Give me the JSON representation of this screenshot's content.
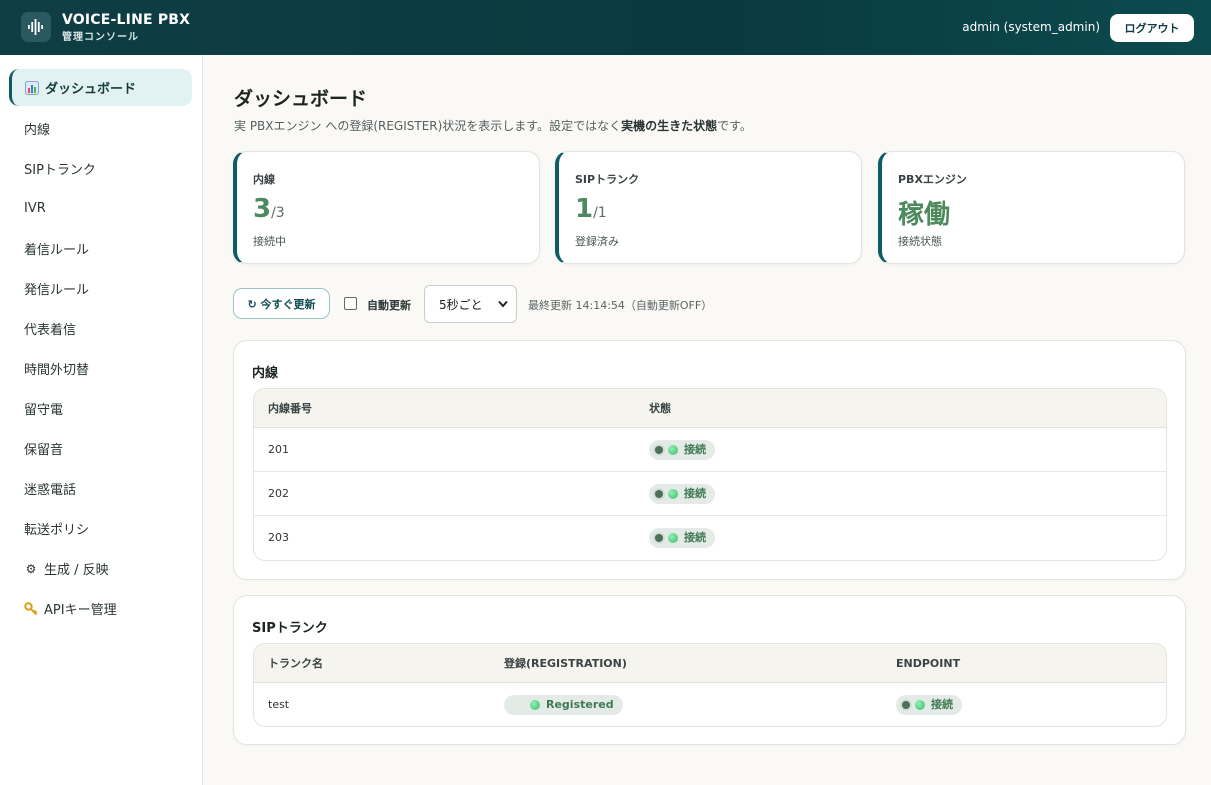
{
  "app": {
    "title": "VOICE-LINE PBX",
    "subtitle": "管理コンソール"
  },
  "header": {
    "user": "admin (system_admin)",
    "logout_label": "ログアウト"
  },
  "sidebar": {
    "items": [
      {
        "label": "ダッシュボード",
        "icon": "chart-icon",
        "active": true
      },
      {
        "label": "内線"
      },
      {
        "label": "SIPトランク"
      },
      {
        "label": "IVR"
      },
      {
        "label": "着信ルール"
      },
      {
        "label": "発信ルール"
      },
      {
        "label": "代表着信"
      },
      {
        "label": "時間外切替"
      },
      {
        "label": "留守電"
      },
      {
        "label": "保留音"
      },
      {
        "label": "迷惑電話"
      },
      {
        "label": "転送ポリシ"
      },
      {
        "label": "生成 / 反映",
        "icon": "gear-icon"
      },
      {
        "label": "APIキー管理",
        "icon": "key-icon"
      }
    ]
  },
  "page": {
    "title": "ダッシュボード",
    "desc_prefix": "実 PBXエンジン への登録(REGISTER)状況を表示します。設定ではなく",
    "desc_bold": "実機の生きた状態",
    "desc_suffix": "です。"
  },
  "stats": [
    {
      "label": "内線",
      "value": "3",
      "total": "/3",
      "sub": "接続中"
    },
    {
      "label": "SIPトランク",
      "value": "1",
      "total": "/1",
      "sub": "登録済み"
    },
    {
      "label": "PBXエンジン",
      "value": "稼働",
      "total": "",
      "sub": "接続状態"
    }
  ],
  "controls": {
    "refresh_label": "↻ 今すぐ更新",
    "auto_label": "自動更新",
    "auto_checked": false,
    "interval_value": "5秒ごと",
    "last_update": "最終更新 14:14:54（自動更新OFF）"
  },
  "extensions": {
    "title": "内線",
    "columns": [
      "内線番号",
      "状態"
    ],
    "rows": [
      {
        "number": "201",
        "status": "接続"
      },
      {
        "number": "202",
        "status": "接続"
      },
      {
        "number": "203",
        "status": "接続"
      }
    ]
  },
  "trunks": {
    "title": "SIPトランク",
    "columns": [
      "トランク名",
      "登録(REGISTRATION)",
      "ENDPOINT"
    ],
    "rows": [
      {
        "name": "test",
        "registration": "Registered",
        "endpoint": "接続"
      }
    ]
  },
  "colors": {
    "brand_dark": "#0f3d44",
    "accent": "#0f5d63",
    "ok_green": "#4c8a5e"
  }
}
